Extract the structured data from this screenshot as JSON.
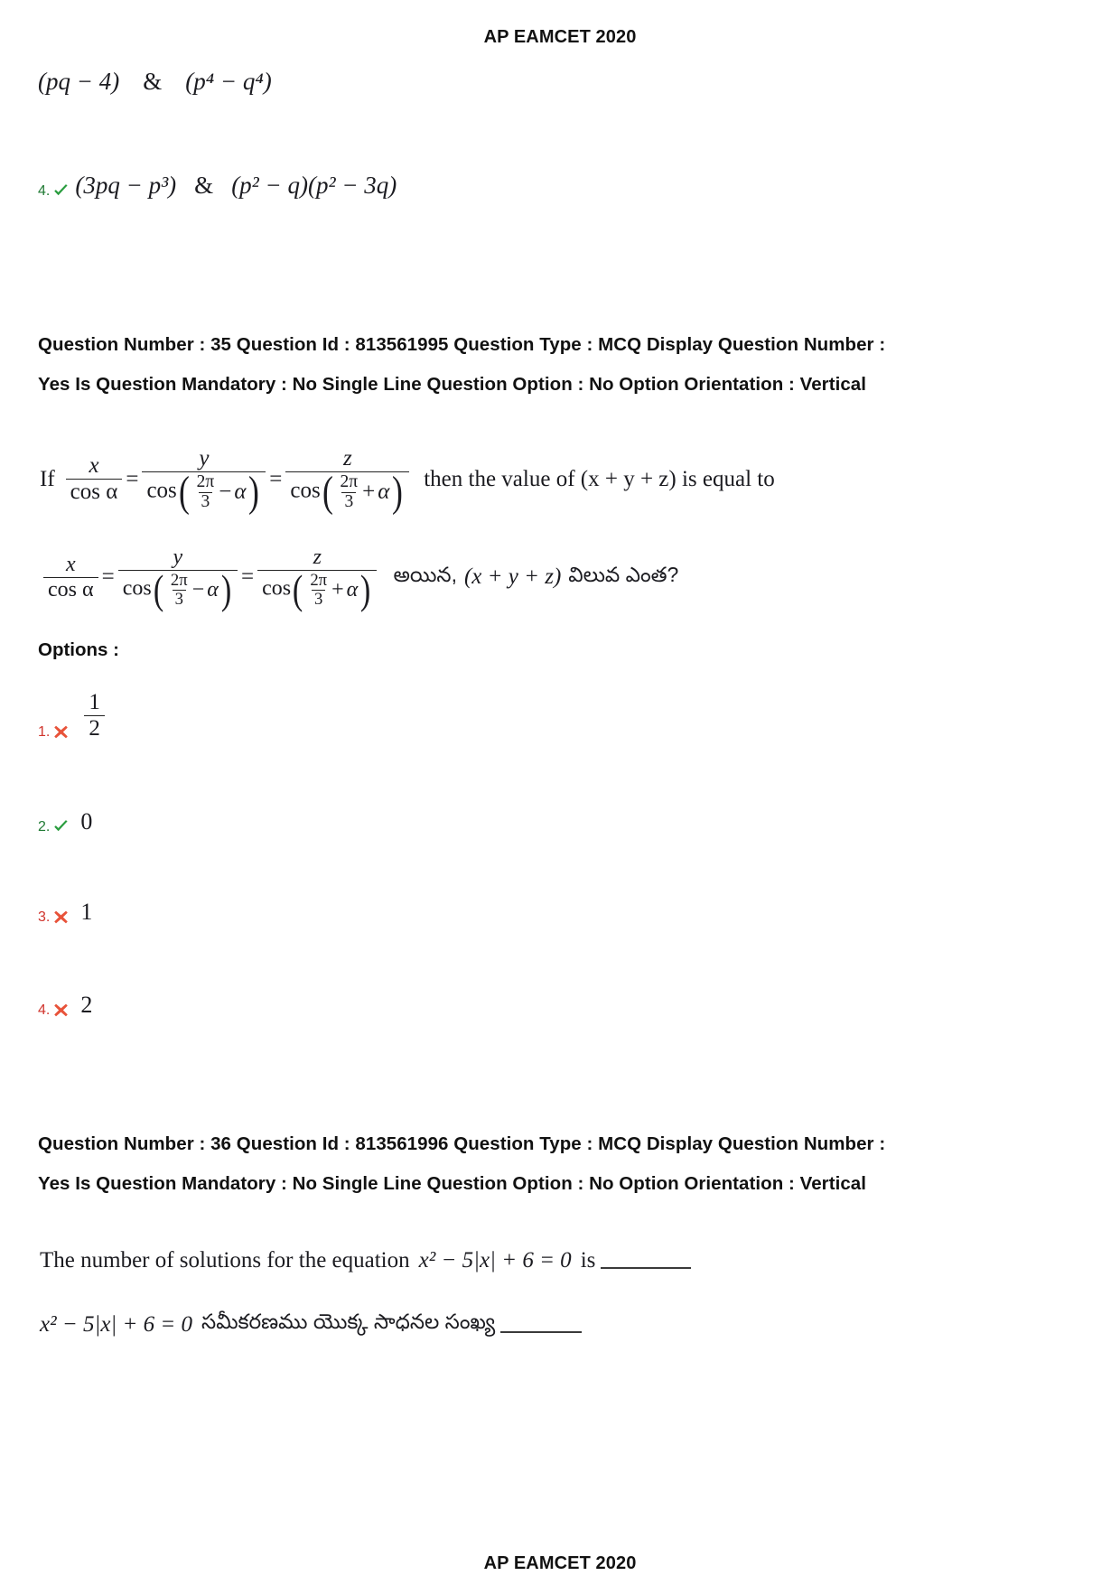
{
  "page": {
    "header": "AP EAMCET 2020",
    "footer": "AP EAMCET 2020"
  },
  "previous_question_tail": {
    "option3": {
      "left": "(pq − 4)",
      "amp": "&",
      "right": "(p⁴ − q⁴)"
    },
    "option4": {
      "number": "4.",
      "mark": "correct-tick-icon",
      "left_open": "(",
      "left": "3pq − p³",
      "left_close": ")",
      "amp": "&",
      "right": "(p² − q)(p² − 3q)"
    }
  },
  "questions": [
    {
      "meta": "Question Number : 35 Question Id : 813561995 Question Type : MCQ Display Question Number : Yes Is Question Mandatory : No Single Line Question Option : No Option Orientation : Vertical",
      "meta_parts": {
        "question_number_label": "Question Number :",
        "question_number": "35",
        "question_id_label": "Question Id :",
        "question_id": "813561995",
        "question_type_label": "Question Type :",
        "question_type": "MCQ",
        "display_question_number_label": "Display Question Number :",
        "display_question_number": "Yes",
        "is_question_mandatory_label": "Is Question Mandatory :",
        "is_question_mandatory": "No",
        "single_line_question_option_label": "Single Line Question Option :",
        "single_line_question_option": "No",
        "option_orientation_label": "Option Orientation :",
        "option_orientation": "Vertical"
      },
      "stem_en": {
        "lead": "If",
        "num1": "x",
        "den1": "cos α",
        "eq1": "=",
        "num2": "y",
        "den2_fn": "cos",
        "den2_frac_num": "2π",
        "den2_frac_den": "3",
        "den2_sign": "−",
        "den2_alpha": "α",
        "eq2": "=",
        "num3": "z",
        "den3_fn": "cos",
        "den3_frac_num": "2π",
        "den3_frac_den": "3",
        "den3_sign": "+",
        "den3_alpha": "α",
        "tail": "then the value of (x + y + z) is equal to"
      },
      "stem_te": {
        "num1": "x",
        "den1": "cos α",
        "eq1": "=",
        "num2": "y",
        "den2_fn": "cos",
        "den2_frac_num": "2π",
        "den2_frac_den": "3",
        "den2_sign": "−",
        "den2_alpha": "α",
        "eq2": "=",
        "num3": "z",
        "den3_fn": "cos",
        "den3_frac_num": "2π",
        "den3_frac_den": "3",
        "den3_sign": "+",
        "den3_alpha": "α",
        "tail_a": "అయిన,",
        "tail_expr": "(x + y + z)",
        "tail_b": "విలువ ఎంత?"
      },
      "options_label": "Options :",
      "options": [
        {
          "number": "1.",
          "status": "wrong",
          "mark": "wrong-cross-icon",
          "type": "fraction",
          "num": "1",
          "den": "2",
          "value": "1/2"
        },
        {
          "number": "2.",
          "status": "correct",
          "mark": "correct-tick-icon",
          "type": "plain",
          "value": "0"
        },
        {
          "number": "3.",
          "status": "wrong",
          "mark": "wrong-cross-icon",
          "type": "plain",
          "value": "1"
        },
        {
          "number": "4.",
          "status": "wrong",
          "mark": "wrong-cross-icon",
          "type": "plain",
          "value": "2"
        }
      ]
    },
    {
      "meta": "Question Number : 36 Question Id : 813561996 Question Type : MCQ Display Question Number : Yes Is Question Mandatory : No Single Line Question Option : No Option Orientation : Vertical",
      "meta_parts": {
        "question_number_label": "Question Number :",
        "question_number": "36",
        "question_id_label": "Question Id :",
        "question_id": "813561996",
        "question_type_label": "Question Type :",
        "question_type": "MCQ",
        "display_question_number_label": "Display Question Number :",
        "display_question_number": "Yes",
        "is_question_mandatory_label": "Is Question Mandatory :",
        "is_question_mandatory": "No",
        "single_line_question_option_label": "Single Line Question Option :",
        "single_line_question_option": "No",
        "option_orientation_label": "Option Orientation :",
        "option_orientation": "Vertical"
      },
      "stem_en": {
        "lead": "The number of solutions for the equation",
        "expr": "x² − 5|x| + 6 = 0",
        "tail": "is"
      },
      "stem_te": {
        "expr": "x² − 5|x| + 6 = 0",
        "tail": "సమీకరణము యొక్క సాధనల సంఖ్య"
      }
    }
  ],
  "colors": {
    "correct_green": "#2a9d3f",
    "wrong_red": "#e8533a",
    "number_green": "#1f7a33",
    "number_red": "#d0342c",
    "text": "#1b1b20"
  }
}
